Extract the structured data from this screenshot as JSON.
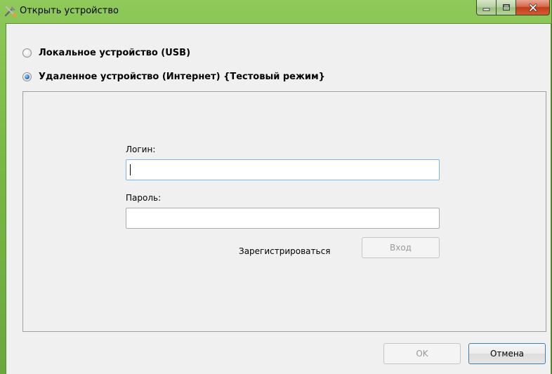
{
  "window": {
    "title": "Открыть устройство",
    "app_icon": "tools-icon",
    "controls": [
      "minimize-icon",
      "maximize-icon",
      "close-icon"
    ]
  },
  "connection": {
    "options": [
      {
        "label": "Локальное устройство (USB)",
        "selected": false
      },
      {
        "label": "Удаленное устройство (Интернет) {Тестовый режим}",
        "selected": true
      }
    ]
  },
  "login_form": {
    "login_label": "Логин:",
    "login_value": "",
    "password_label": "Пароль:",
    "password_value": "",
    "register_label": "Зарегистрироваться",
    "enter_label": "Вход"
  },
  "footer": {
    "ok_label": "OK",
    "cancel_label": "Отмена"
  },
  "colors": {
    "frame": "#79b948",
    "client_bg": "#f0f0f0",
    "close_button": "#c23d1b",
    "focus_border": "#7eb4ea"
  }
}
